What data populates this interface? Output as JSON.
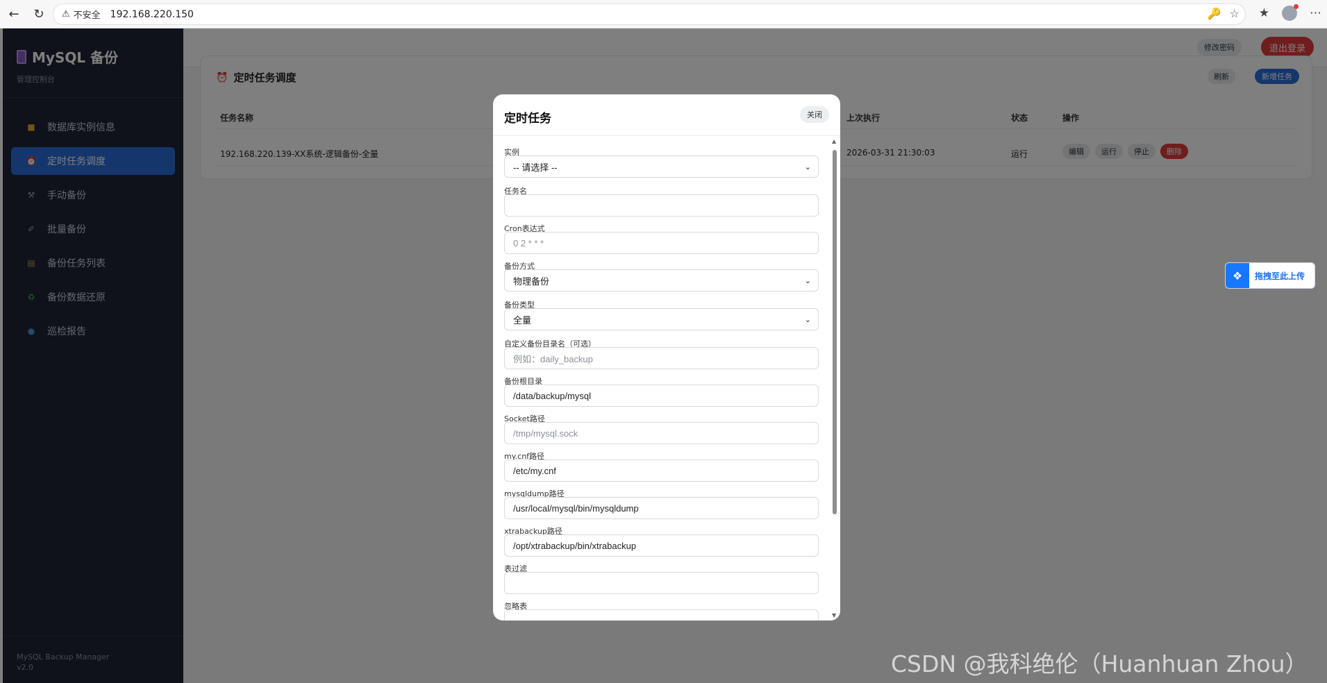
{
  "browser": {
    "insecure_label": "不安全",
    "url": "192.168.220.150"
  },
  "app": {
    "brand_title": "MySQL 备份",
    "brand_subtitle": "管理控制台",
    "menu": [
      {
        "label": "数据库实例信息",
        "icon": "folder-icon",
        "color": "#e8a93a"
      },
      {
        "label": "定时任务调度",
        "icon": "alarm-clock-icon",
        "color": "#e0453a"
      },
      {
        "label": "手动备份",
        "icon": "tools-icon",
        "color": "#9aa3b1"
      },
      {
        "label": "批量备份",
        "icon": "paperclip-icon",
        "color": "#9aa3b1"
      },
      {
        "label": "备份任务列表",
        "icon": "clipboard-icon",
        "color": "#c99a5e"
      },
      {
        "label": "备份数据还原",
        "icon": "recycle-icon",
        "color": "#3aa65b"
      },
      {
        "label": "巡检报告",
        "icon": "magnifier-icon",
        "color": "#4a90d9"
      }
    ],
    "active_menu_index": 1,
    "footer_name": "MySQL Backup Manager",
    "footer_version": "v2.0",
    "topbar": {
      "change_password": "修改密码",
      "logout": "退出登录"
    },
    "card": {
      "title": "定时任务调度",
      "refresh": "刷新",
      "add_task": "新增任务",
      "columns": {
        "name": "任务名称",
        "last_run": "上次执行",
        "status": "状态",
        "actions": "操作"
      },
      "row": {
        "name": "192.168.220.139-XX系统-逻辑备份-全量",
        "last_run": "2026-03-31 21:30:03",
        "status": "运行",
        "edit": "编辑",
        "run": "运行",
        "stop": "停止",
        "delete": "删除"
      }
    },
    "upload_widget": "拖拽至此上传"
  },
  "modal": {
    "title": "定时任务",
    "close": "关闭",
    "fields": {
      "instance": {
        "label": "实例",
        "value": "-- 请选择 --"
      },
      "task_name": {
        "label": "任务名",
        "value": ""
      },
      "cron": {
        "label": "Cron表达式",
        "placeholder": "0 2 * * *"
      },
      "method": {
        "label": "备份方式",
        "value": "物理备份"
      },
      "type": {
        "label": "备份类型",
        "value": "全量"
      },
      "custom_dir": {
        "label": "自定义备份目录名（可选）",
        "placeholder": "例如：daily_backup"
      },
      "root_dir": {
        "label": "备份根目录",
        "value": "/data/backup/mysql"
      },
      "socket": {
        "label": "Socket路径",
        "placeholder": "/tmp/mysql.sock"
      },
      "mycnf": {
        "label": "my.cnf路径",
        "value": "/etc/my.cnf"
      },
      "mysqldump": {
        "label": "mysqldump路径",
        "value": "/usr/local/mysql/bin/mysqldump"
      },
      "xtrabackup": {
        "label": "xtrabackup路径",
        "value": "/opt/xtrabackup/bin/xtrabackup"
      },
      "table_filter": {
        "label": "表过滤",
        "value": ""
      },
      "ignore_tables": {
        "label": "忽略表"
      }
    }
  },
  "watermark": "CSDN @我科绝伦（Huanhuan Zhou）"
}
